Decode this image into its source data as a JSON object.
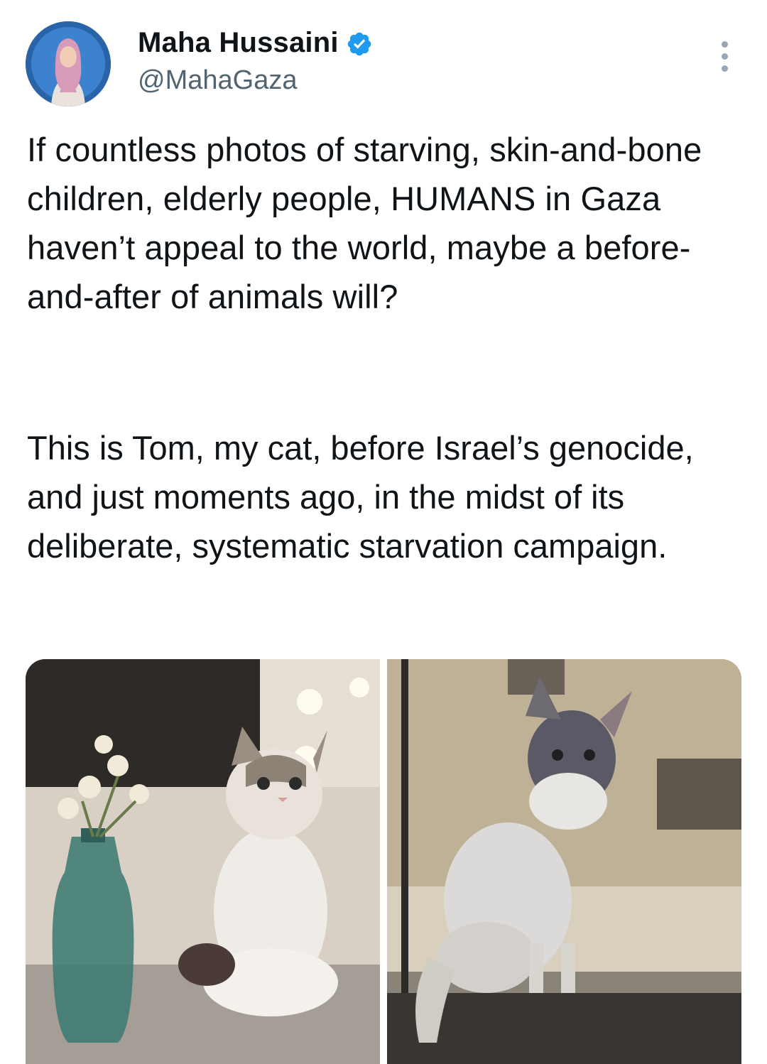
{
  "author": {
    "display_name": "Maha Hussaini",
    "handle": "@MahaGaza",
    "verified_icon": "verified-badge-icon",
    "verified_color": "#1d9bf0"
  },
  "tweet": {
    "paragraphs": [
      "If countless photos of starving, skin-and-bone children, elderly people, HUMANS in Gaza haven’t appeal to the world, maybe a before-and-after of animals will?",
      "This is Tom, my cat, before Israel’s genocide, and just moments ago, in the midst of its deliberate, systematic starvation campaign."
    ]
  },
  "media": {
    "photos": [
      {
        "icon": "cat-before-photo"
      },
      {
        "icon": "cat-after-photo"
      }
    ]
  },
  "more_icon": "more-options-icon"
}
